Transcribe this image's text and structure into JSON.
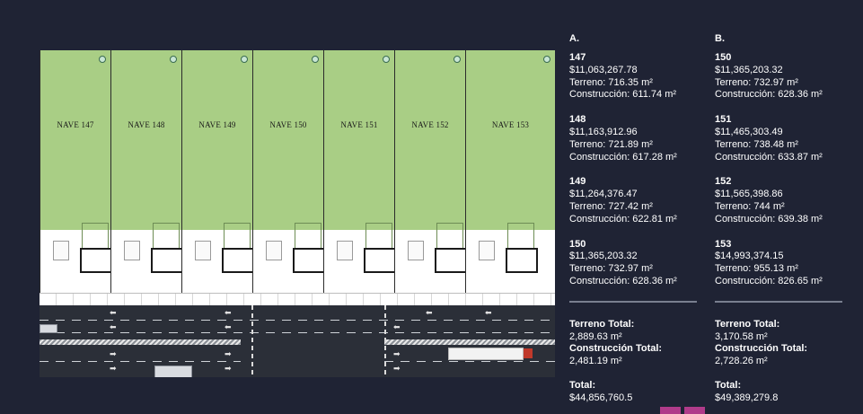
{
  "plan": {
    "naves": [
      {
        "label": "NAVE 147"
      },
      {
        "label": "NAVE 148"
      },
      {
        "label": "NAVE 149"
      },
      {
        "label": "NAVE 150"
      },
      {
        "label": "NAVE 151"
      },
      {
        "label": "NAVE 152"
      },
      {
        "label": "NAVE 153"
      }
    ],
    "colors": {
      "lot": "#a9ce85",
      "road": "#2b2f38",
      "truck_cab": "#c0392b"
    }
  },
  "columns": [
    {
      "header": "A.",
      "entries": [
        {
          "number": "147",
          "price": "$11,063,267.78",
          "terreno": "Terreno: 716.35 m²",
          "construccion": "Construcción: 611.74 m²"
        },
        {
          "number": "148",
          "price": "$11,163,912.96",
          "terreno": "Terreno: 721.89 m²",
          "construccion": "Construcción: 617.28 m²"
        },
        {
          "number": "149",
          "price": "$11,264,376.47",
          "terreno": "Terreno: 727.42 m²",
          "construccion": "Construcción: 622.81 m²"
        },
        {
          "number": "150",
          "price": "$11,365,203.32",
          "terreno": "Terreno: 732.97 m²",
          "construccion": "Construcción: 628.36 m²"
        }
      ],
      "totals": {
        "terreno_label": "Terreno Total:",
        "terreno_value": "2,889.63 m²",
        "construccion_label": "Construcción Total:",
        "construccion_value": "2,481.19 m²",
        "total_label": "Total:",
        "total_value": "$44,856,760.5"
      }
    },
    {
      "header": "B.",
      "entries": [
        {
          "number": "150",
          "price": "$11,365,203.32",
          "terreno": "Terreno: 732.97 m²",
          "construccion": "Construcción: 628.36 m²"
        },
        {
          "number": "151",
          "price": "$11,465,303.49",
          "terreno": "Terreno: 738.48 m²",
          "construccion": "Construcción: 633.87 m²"
        },
        {
          "number": "152",
          "price": "$11,565,398.86",
          "terreno": "Terreno: 744 m²",
          "construccion": "Construcción: 639.38 m²"
        },
        {
          "number": "153",
          "price": "$14,993,374.15",
          "terreno": "Terreno: 955.13 m²",
          "construccion": "Construcción: 826.65 m²"
        }
      ],
      "totals": {
        "terreno_label": "Terreno Total:",
        "terreno_value": "3,170.58 m²",
        "construccion_label": "Construcción Total:",
        "construccion_value": "2,728.26 m²",
        "total_label": "Total:",
        "total_value": "$49,389,279.8"
      }
    }
  ],
  "accent_color": "#b03b8a"
}
